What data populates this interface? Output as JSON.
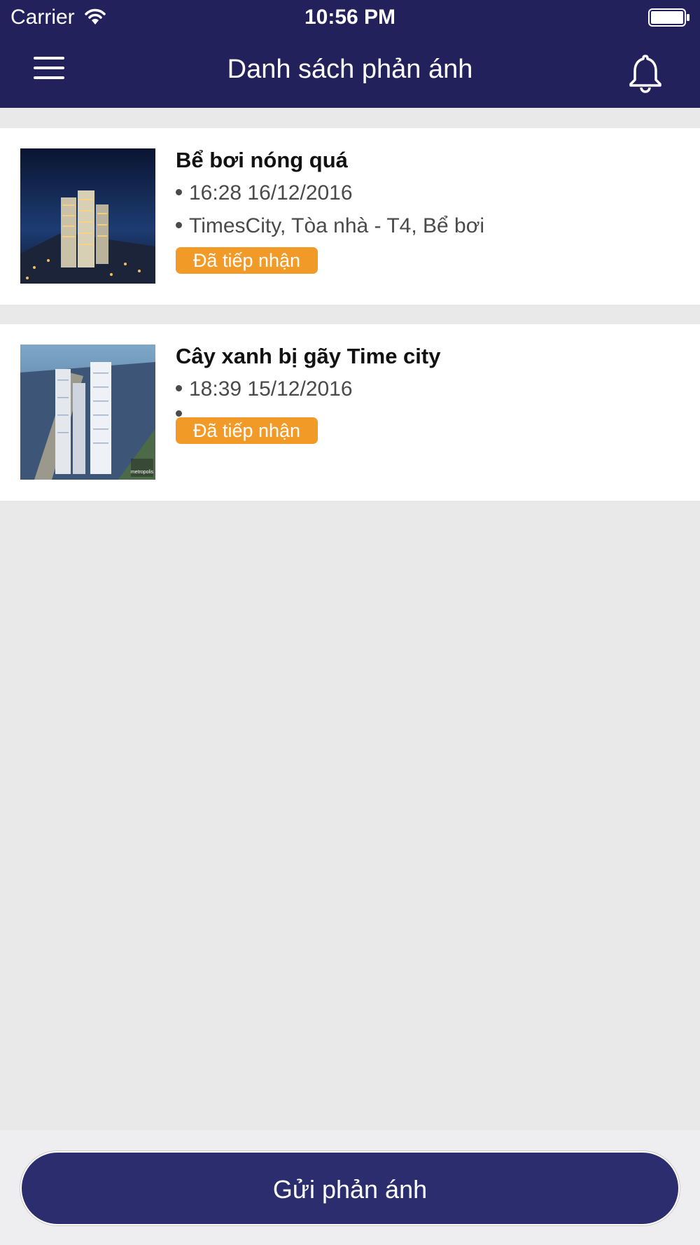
{
  "status_bar": {
    "carrier": "Carrier",
    "time": "10:56 PM"
  },
  "header": {
    "title": "Danh sách phản ánh",
    "menu_icon": "menu-icon",
    "notification_icon": "bell-icon"
  },
  "reports": [
    {
      "title": "Bể bơi nóng quá",
      "time": "16:28 16/12/2016",
      "location": "TimesCity, Tòa nhà - T4, Bể bơi",
      "status": "Đã tiếp nhận"
    },
    {
      "title": "Cây xanh bị gãy Time city",
      "time": "18:39 15/12/2016",
      "location": "",
      "status": "Đã tiếp nhận",
      "thumb_watermark": "metropolis"
    }
  ],
  "footer": {
    "send_label": "Gửi phản ánh"
  },
  "colors": {
    "header_bg": "#22215c",
    "badge": "#f29a27",
    "button_bg": "#2b2d6e",
    "page_bg": "#e9e9ea"
  }
}
